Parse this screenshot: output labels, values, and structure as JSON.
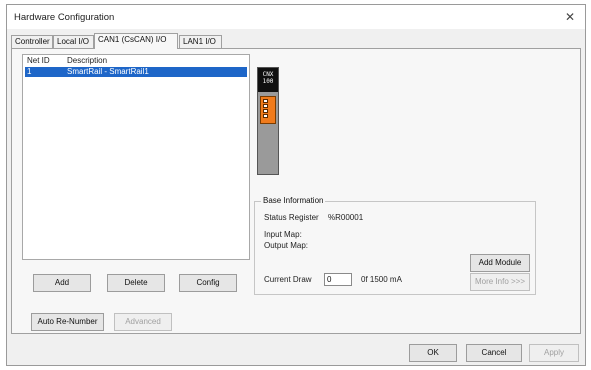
{
  "window": {
    "title": "Hardware Configuration",
    "close_icon": "close-icon"
  },
  "tabs": [
    {
      "label": "Controller",
      "active": false
    },
    {
      "label": "Local I/O",
      "active": false
    },
    {
      "label": "CAN1 (CsCAN) I/O",
      "active": true
    },
    {
      "label": "LAN1 I/O",
      "active": false
    }
  ],
  "list": {
    "headers": {
      "net_id": "Net ID",
      "description": "Description"
    },
    "rows": [
      {
        "net_id": "1",
        "description": "SmartRail - SmartRail1"
      }
    ]
  },
  "buttons": {
    "add": "Add",
    "delete": "Delete",
    "config": "Config",
    "auto_renumber": "Auto Re-Number",
    "advanced": "Advanced",
    "add_module": "Add Module",
    "more_info": "More Info >>>",
    "ok": "OK",
    "cancel": "Cancel",
    "apply": "Apply"
  },
  "module": {
    "label_line1": "CNX",
    "label_line2": "100",
    "connector_color": "#f07b1c"
  },
  "base_info": {
    "legend": "Base Information",
    "status_register_label": "Status Register",
    "status_register_value": "%R00001",
    "input_map_label": "Input Map:",
    "output_map_label": "Output Map:",
    "current_draw_label": "Current Draw",
    "current_draw_value": "0",
    "current_draw_max": "0f 1500 mA"
  },
  "colors": {
    "selection": "#1e66c8",
    "background": "#f0f0f0"
  }
}
